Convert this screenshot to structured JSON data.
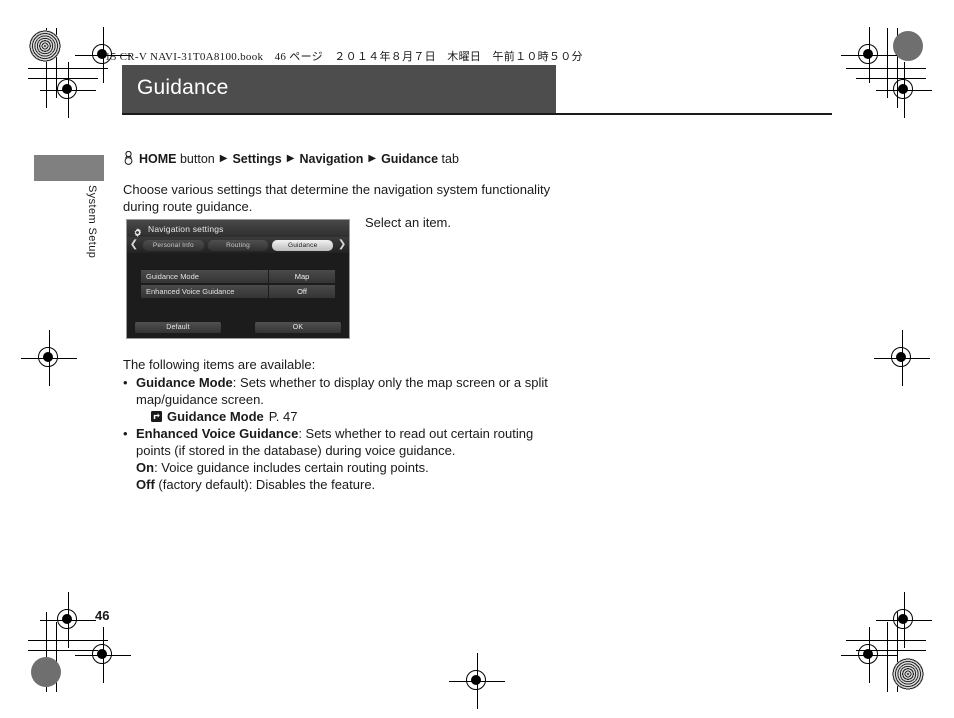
{
  "print_header": "15 CR-V NAVI-31T0A8100.book　46 ページ　２０１４年８月７日　木曜日　午前１０時５０分",
  "chapter": {
    "title": "Guidance",
    "side_tab_label": "System Setup",
    "title_bar_color": "#4d4d4d"
  },
  "breadcrumb": {
    "icon": "home-button-icon",
    "home_label": "HOME",
    "home_suffix": "button",
    "separator": "▶",
    "settings_label": "Settings",
    "navigation_label": "Navigation",
    "guidance_label": "Guidance",
    "guidance_suffix": "tab"
  },
  "body": {
    "intro": "Choose various settings that determine the navigation system functionality during route guidance.",
    "callout": "Select an item.",
    "items_lead": "The following items are available:"
  },
  "nav_mock": {
    "window_title": "Navigation settings",
    "gear_icon": "gear-icon",
    "prev_arrow": "❮",
    "next_arrow": "❯",
    "tabs": [
      {
        "label": "Personal Info",
        "active": false
      },
      {
        "label": "Routing",
        "active": false
      },
      {
        "label": "Guidance",
        "active": true
      }
    ],
    "rows": [
      {
        "label": "Guidance Mode",
        "value": "Map"
      },
      {
        "label": "Enhanced Voice Guidance",
        "value": "Off"
      }
    ],
    "default_button": "Default",
    "ok_button": "OK"
  },
  "items": [
    {
      "term": "Guidance Mode",
      "term_suffix": ": Sets whether to display only the map screen or a split map/guidance screen.",
      "xref": {
        "icon": "cross-reference-icon",
        "label": "Guidance Mode",
        "page": "P. 47"
      }
    },
    {
      "term": "Enhanced Voice Guidance",
      "term_suffix": ": Sets whether to read out certain routing points (if stored in the database) during voice guidance.",
      "sub_on_term": "On",
      "sub_on_text": ": Voice guidance includes certain routing points.",
      "sub_off_term": "Off",
      "sub_off_text": " (factory default): Disables the feature."
    }
  ],
  "page_number": "46"
}
